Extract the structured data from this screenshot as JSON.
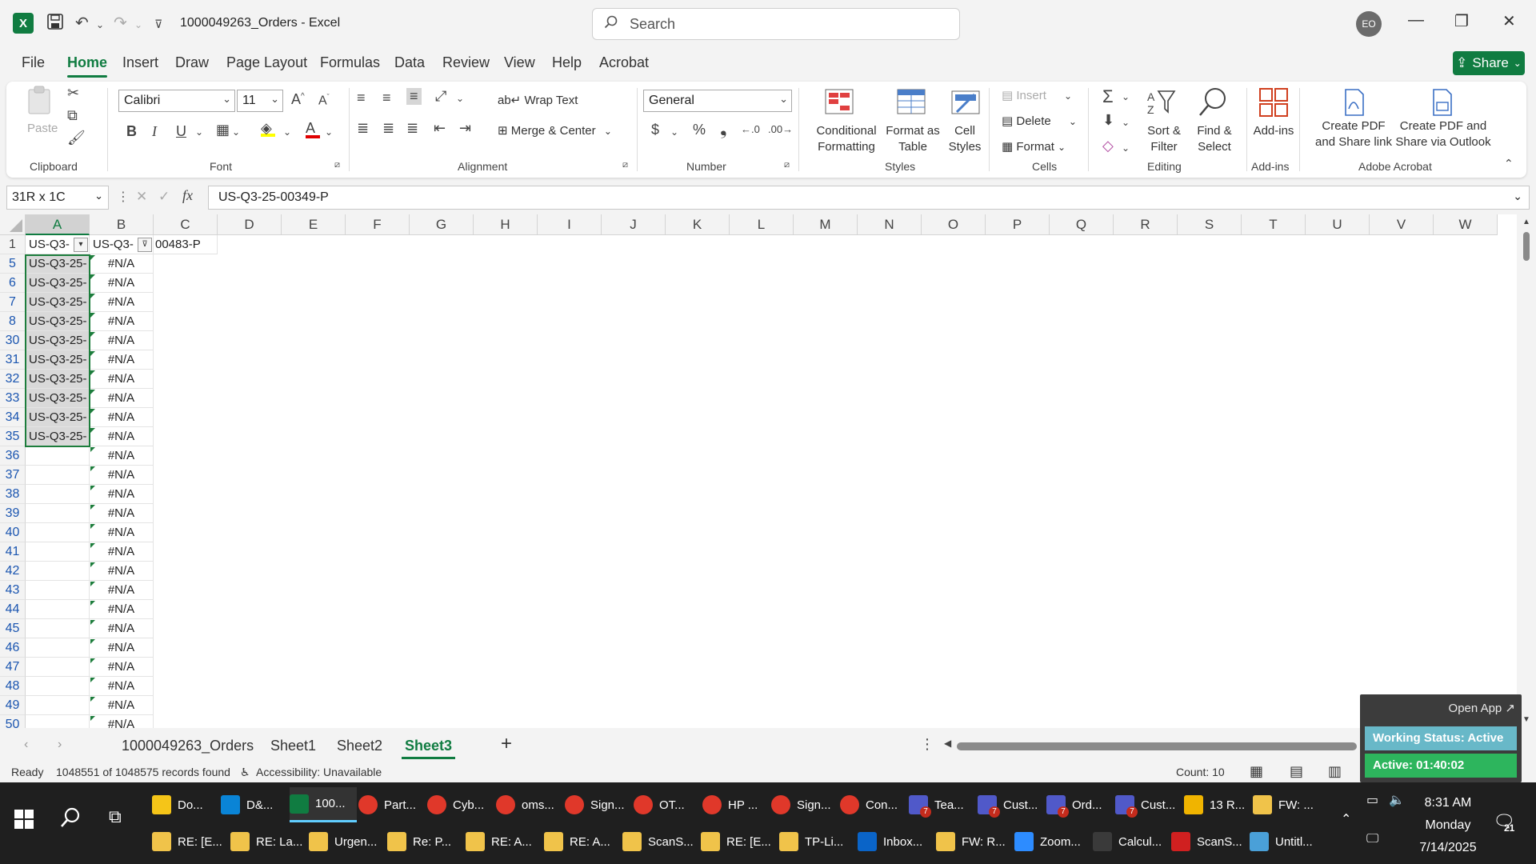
{
  "window": {
    "title": "1000049263_Orders  -  Excel",
    "search_placeholder": "Search",
    "avatar_initials": "EO"
  },
  "menu": {
    "tabs": [
      "File",
      "Home",
      "Insert",
      "Draw",
      "Page Layout",
      "Formulas",
      "Data",
      "Review",
      "View",
      "Help",
      "Acrobat"
    ],
    "active": "Home",
    "share_label": "Share"
  },
  "ribbon": {
    "clipboard": {
      "label": "Clipboard",
      "paste": "Paste"
    },
    "font": {
      "label": "Font",
      "family": "Calibri",
      "size": "11"
    },
    "alignment": {
      "label": "Alignment",
      "wrap_text": "Wrap Text",
      "merge_center": "Merge & Center"
    },
    "number": {
      "label": "Number",
      "format": "General"
    },
    "styles": {
      "label": "Styles",
      "conditional_formatting": "Conditional\nFormatting",
      "format_as_table": "Format as\nTable",
      "cell_styles": "Cell\nStyles"
    },
    "cells": {
      "label": "Cells",
      "insert": "Insert",
      "delete": "Delete",
      "format": "Format"
    },
    "editing": {
      "label": "Editing",
      "sort_filter": "Sort &\nFilter",
      "find_select": "Find &\nSelect"
    },
    "addins": {
      "label": "Add-ins",
      "addins": "Add-ins"
    },
    "acrobat": {
      "label": "Adobe Acrobat",
      "create_pdf_link": "Create PDF\nand Share link",
      "create_pdf_outlook": "Create PDF and\nShare via Outlook"
    }
  },
  "formula_bar": {
    "name_box": "31R x 1C",
    "formula": "US-Q3-25-00349-P"
  },
  "grid": {
    "columns": [
      "A",
      "B",
      "C",
      "D",
      "E",
      "F",
      "G",
      "H",
      "I",
      "J",
      "K",
      "L",
      "M",
      "N",
      "O",
      "P",
      "Q",
      "R",
      "S",
      "T",
      "U",
      "V",
      "W"
    ],
    "header_row": {
      "row": "1",
      "a": "US-Q3-",
      "b": "US-Q3-",
      "c": "00483-P"
    },
    "rows": [
      {
        "num": "5",
        "a": "US-Q3-25-",
        "b": "#N/A"
      },
      {
        "num": "6",
        "a": "US-Q3-25-",
        "b": "#N/A"
      },
      {
        "num": "7",
        "a": "US-Q3-25-",
        "b": "#N/A"
      },
      {
        "num": "8",
        "a": "US-Q3-25-",
        "b": "#N/A"
      },
      {
        "num": "30",
        "a": "US-Q3-25-",
        "b": "#N/A"
      },
      {
        "num": "31",
        "a": "US-Q3-25-",
        "b": "#N/A"
      },
      {
        "num": "32",
        "a": "US-Q3-25-",
        "b": "#N/A"
      },
      {
        "num": "33",
        "a": "US-Q3-25-",
        "b": "#N/A"
      },
      {
        "num": "34",
        "a": "US-Q3-25-",
        "b": "#N/A"
      },
      {
        "num": "35",
        "a": "US-Q3-25-",
        "b": "#N/A"
      },
      {
        "num": "36",
        "a": "",
        "b": "#N/A"
      },
      {
        "num": "37",
        "a": "",
        "b": "#N/A"
      },
      {
        "num": "38",
        "a": "",
        "b": "#N/A"
      },
      {
        "num": "39",
        "a": "",
        "b": "#N/A"
      },
      {
        "num": "40",
        "a": "",
        "b": "#N/A"
      },
      {
        "num": "41",
        "a": "",
        "b": "#N/A"
      },
      {
        "num": "42",
        "a": "",
        "b": "#N/A"
      },
      {
        "num": "43",
        "a": "",
        "b": "#N/A"
      },
      {
        "num": "44",
        "a": "",
        "b": "#N/A"
      },
      {
        "num": "45",
        "a": "",
        "b": "#N/A"
      },
      {
        "num": "46",
        "a": "",
        "b": "#N/A"
      },
      {
        "num": "47",
        "a": "",
        "b": "#N/A"
      },
      {
        "num": "48",
        "a": "",
        "b": "#N/A"
      },
      {
        "num": "49",
        "a": "",
        "b": "#N/A"
      },
      {
        "num": "50",
        "a": "",
        "b": "#N/A"
      }
    ]
  },
  "sheets": {
    "tabs": [
      "1000049263_Orders",
      "Sheet1",
      "Sheet2",
      "Sheet3"
    ],
    "active": "Sheet3"
  },
  "status": {
    "ready": "Ready",
    "records": "1048551 of 1048575 records found",
    "accessibility": "Accessibility: Unavailable",
    "count": "Count: 10"
  },
  "widget": {
    "open_app": "Open App ↗",
    "working_status": "Working Status: Active",
    "active_timer": "Active: 01:40:02"
  },
  "taskbar": {
    "row1": [
      "Do...",
      "D&...",
      "100...",
      "Part...",
      "Cyb...",
      "oms...",
      "Sign...",
      "OT...",
      "HP ...",
      "Sign...",
      "Con...",
      "Tea...",
      "Cust...",
      "Ord...",
      "Cust...",
      "13 R...",
      "FW: ..."
    ],
    "row2": [
      "RE: [E...",
      "RE: La...",
      "Urgen...",
      "Re: P...",
      "RE: A...",
      "RE: A...",
      "ScanS...",
      "RE: [E...",
      "TP-Li...",
      "Inbox...",
      "FW: R...",
      "Zoom...",
      "Calcul...",
      "ScanS...",
      "Untitl..."
    ],
    "time": "8:31 AM",
    "day": "Monday",
    "date": "7/14/2025",
    "notifications": "21"
  },
  "colors": {
    "excel_green": "#107c41",
    "selection_green": "#1d7d3c",
    "row_header_blue": "#1a55b0"
  }
}
